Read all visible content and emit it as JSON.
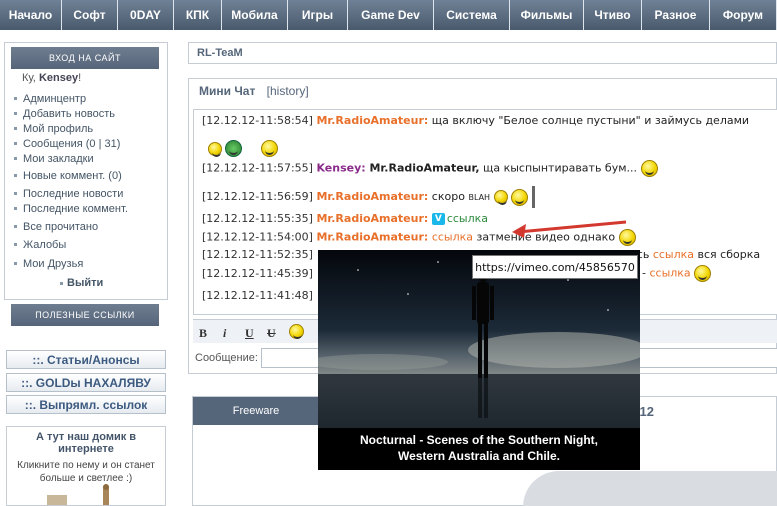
{
  "nav": {
    "items": [
      "Начало",
      "Софт",
      "0DAY",
      "КПК",
      "Мобила",
      "Игры",
      "Game Dev",
      "Система",
      "Фильмы",
      "Чтиво",
      "Разное",
      "Форум"
    ]
  },
  "sidebar": {
    "login_button": "вход на сайт",
    "greeting_prefix": "Ку,",
    "username": "Kensey",
    "greeting_suffix": "!",
    "menu1": [
      "Админцентр",
      "Добавить новость",
      "Мой профиль",
      "Сообщения (0 | 31)",
      "Мои закладки"
    ],
    "menu2": [
      "Новые коммент. (0)"
    ],
    "menu3": [
      "Последние новости",
      "Последние коммент."
    ],
    "menu4": [
      "Все прочитано"
    ],
    "menu5": [
      "Жалобы"
    ],
    "menu6": [
      "Мои Друзья"
    ],
    "logout": "Выйти",
    "useful_links_button": "полезные ссылки",
    "section_links": [
      "::. Статьи/Анонсы",
      "::. GOLDы НАХАЛЯВУ",
      "::. Выпрямл. ссылок"
    ],
    "home_title": "А тут наш домик в интернете",
    "home_text": "Кликните по нему и он станет больше и светлее :)"
  },
  "main": {
    "header_title": "RL-TeaM",
    "chat_tab": "Мини Чат",
    "history_tab": "[history]",
    "messages": [
      {
        "ts": "[12.12.12-11:58:54]",
        "nick": "Mr.RadioAmateur:",
        "text": " ща включу \"Белое солнце пустыни\" и займусь делами"
      },
      {
        "ts": "[12.12.12-11:57:55]",
        "nick": "Kensey:",
        "mention": " Mr.RadioAmateur,",
        "text": " ща кыспынтиравать бум..."
      },
      {
        "ts": "[12.12.12-11:56:59]",
        "nick": "Mr.RadioAmateur:",
        "text": " скоро",
        "extra": "BLAH"
      },
      {
        "ts": "[12.12.12-11:55:35]",
        "nick": "Mr.RadioAmateur:",
        "link": "ссылка",
        "badge": "V"
      },
      {
        "ts": "[12.12.12-11:54:00]",
        "nick": "Mr.RadioAmateur:",
        "link": "ссылка",
        "text": " затмение видео однако"
      },
      {
        "ts": "[12.12.12-11:52:35]",
        "tail_text": "есь",
        "tail_link": "ссылка",
        "tail_text2": " вся сборка"
      },
      {
        "ts": "[12.12.12-11:45:39]",
        "tail_text": "- ",
        "tail_link": "ссылка"
      },
      {
        "ts": "[12.12.12-11:41:48]"
      }
    ],
    "toolbar": [
      "B",
      "i",
      "U",
      "U"
    ],
    "message_label": "Сообщение:",
    "message_value": "",
    "freeware_tab": "Freeware",
    "year": "2012"
  },
  "video": {
    "url": "https://vimeo.com/45856570",
    "caption_line1": "Nocturnal - Scenes of the Southern Night,",
    "caption_line2": "Western Australia and Chile."
  }
}
